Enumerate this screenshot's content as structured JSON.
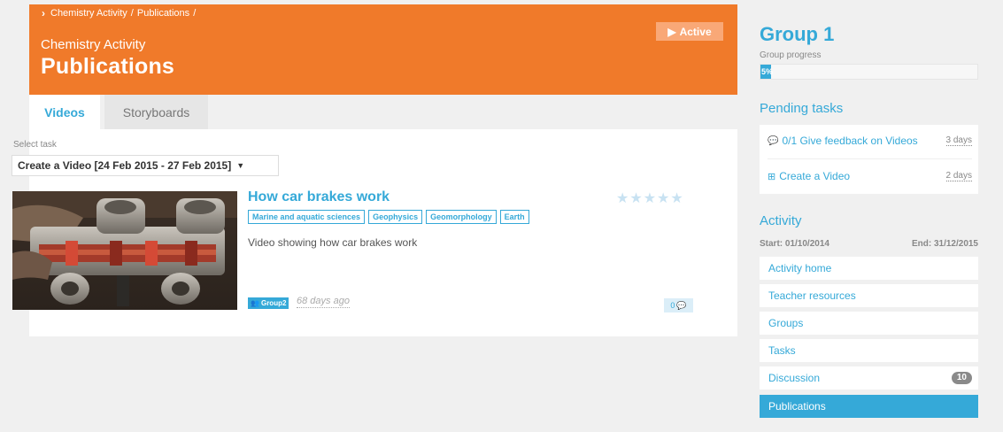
{
  "breadcrumb": {
    "items": [
      "Chemistry Activity",
      "Publications"
    ],
    "separator": "/"
  },
  "header": {
    "subtitle": "Chemistry Activity",
    "title": "Publications",
    "status_label": "Active"
  },
  "tabs": [
    {
      "label": "Videos",
      "active": true
    },
    {
      "label": "Storyboards",
      "active": false
    }
  ],
  "task_select": {
    "label": "Select task",
    "value": "Create a Video [24 Feb 2015 - 27 Feb 2015]"
  },
  "publication": {
    "title": "How car brakes work",
    "tags": [
      "Marine and aquatic sciences",
      "Geophysics",
      "Geomorphology",
      "Earth"
    ],
    "description": "Video showing how car brakes work",
    "rating": 0,
    "max_rating": 5,
    "group_label": "Group2",
    "time_ago": "68 days ago",
    "comments_count": "0"
  },
  "sidebar": {
    "group_title": "Group 1",
    "progress_label": "Group progress",
    "progress_value": 0.05,
    "progress_text": "5%",
    "pending_heading": "Pending tasks",
    "pending_tasks": [
      {
        "label": "0/1 Give feedback on Videos",
        "due": "3 days",
        "icon": "comment-icon"
      },
      {
        "label": "Create a Video",
        "due": "2 days",
        "icon": "document-plus-icon"
      }
    ],
    "activity_heading": "Activity",
    "start_date": "Start: 01/10/2014",
    "end_date": "End: 31/12/2015",
    "nav": [
      {
        "label": "Activity home"
      },
      {
        "label": "Teacher resources"
      },
      {
        "label": "Groups"
      },
      {
        "label": "Tasks"
      },
      {
        "label": "Discussion",
        "count": "10"
      },
      {
        "label": "Publications",
        "active": true
      }
    ]
  },
  "colors": {
    "brand_orange": "#f07a2a",
    "accent_blue": "#35a9d8",
    "page_bg": "#f0f0f0"
  }
}
